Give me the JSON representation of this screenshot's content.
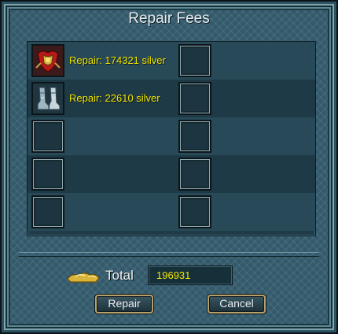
{
  "window": {
    "title": "Repair Fees"
  },
  "items": [
    {
      "icon": "armor-piece-icon",
      "text": "Repair: 174321 silver",
      "filled": true
    },
    {
      "icon": "boots-icon",
      "text": "Repair: 22610 silver",
      "filled": true
    },
    {
      "icon": "",
      "text": "",
      "filled": false
    },
    {
      "icon": "",
      "text": "",
      "filled": false
    },
    {
      "icon": "",
      "text": "",
      "filled": false
    }
  ],
  "total": {
    "icon": "silver-ingot-icon",
    "label": "Total",
    "value": "196931"
  },
  "buttons": {
    "repair": "Repair",
    "cancel": "Cancel"
  },
  "colors": {
    "accent_text": "#f2e600",
    "panel": "#33596a"
  }
}
